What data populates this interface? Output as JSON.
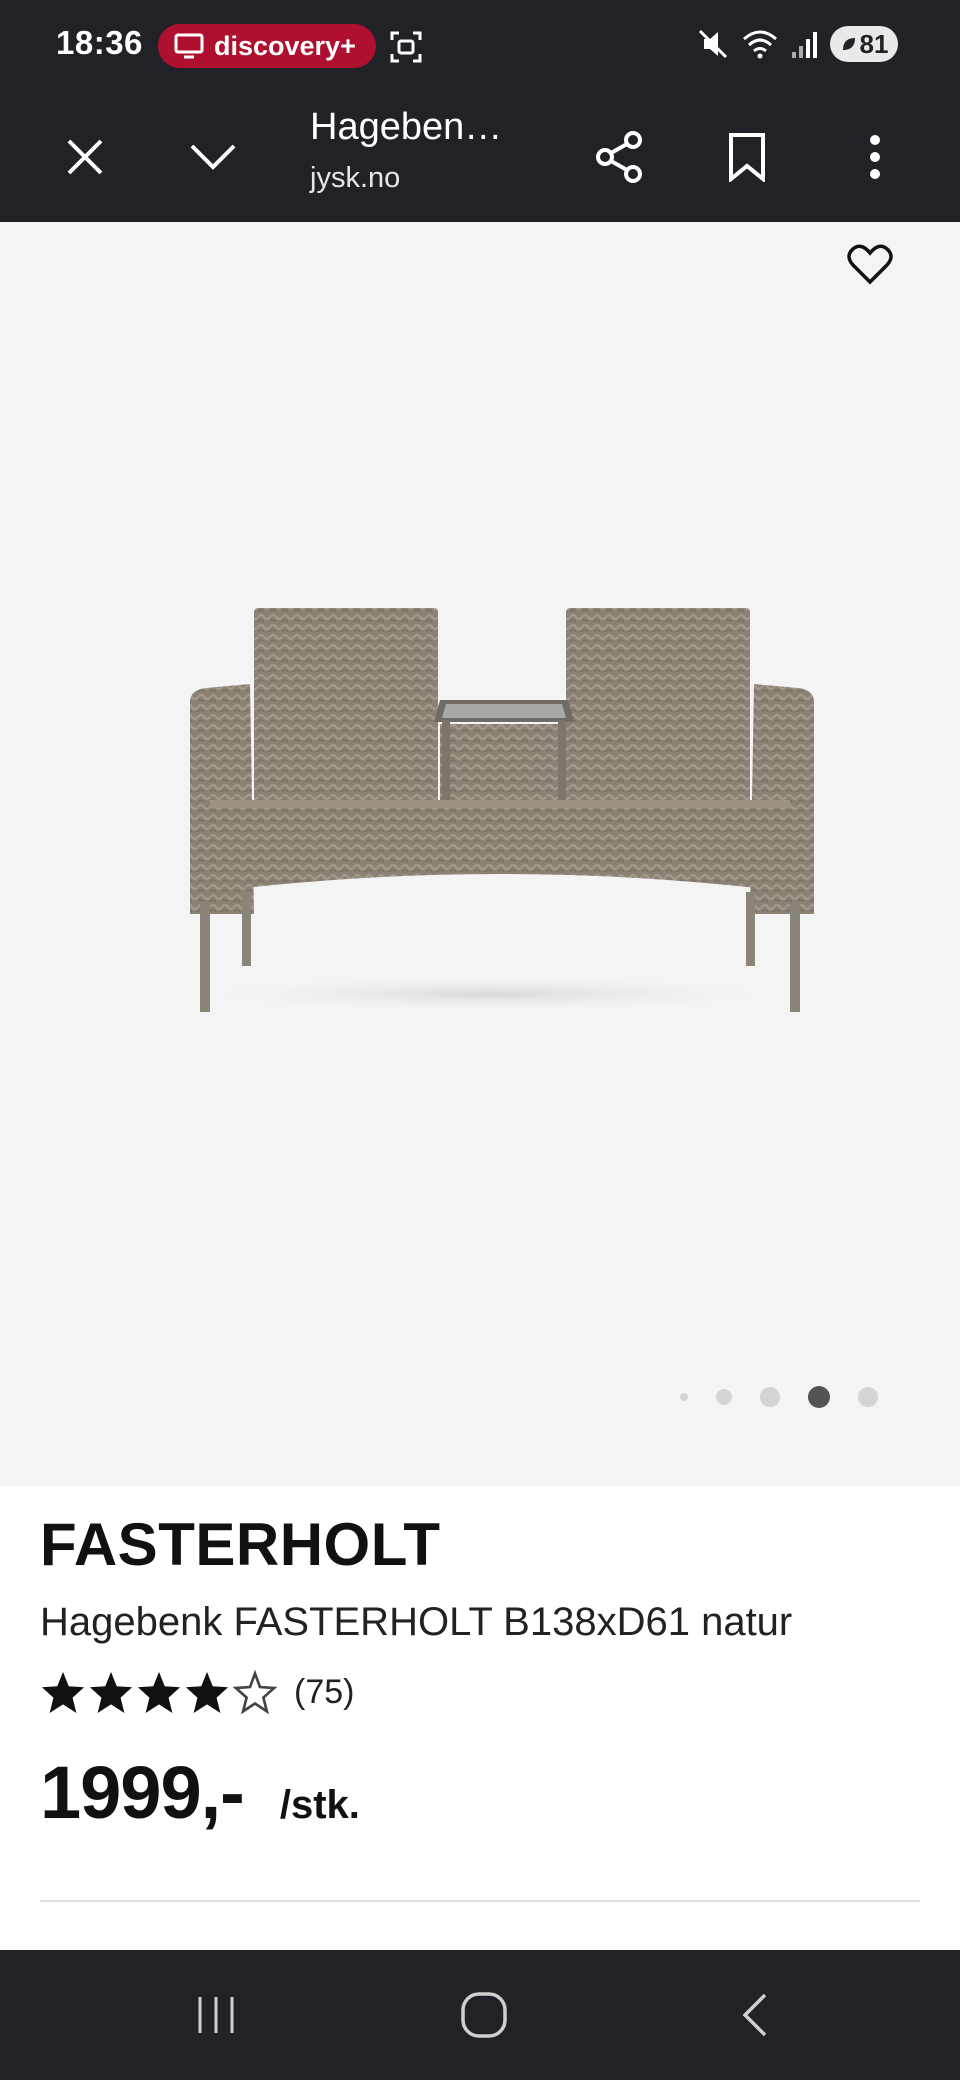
{
  "status": {
    "time": "18:36",
    "pill_label": "discovery+",
    "battery": "81",
    "icons": [
      "tv-icon",
      "screenshot-icon",
      "mute-icon",
      "wifi-icon",
      "signal-icon",
      "battery-icon"
    ]
  },
  "toolbar": {
    "title": "Hageben…",
    "url": "jysk.no",
    "icons": [
      "close-icon",
      "chevron-down-icon",
      "share-icon",
      "bookmark-icon",
      "more-icon"
    ]
  },
  "gallery": {
    "image_alt": "garden-bench-product-image",
    "dots_total": 5,
    "dots_active": 4,
    "favorite_icon": "heart-icon"
  },
  "product": {
    "brand": "FASTERHOLT",
    "name": "Hagebenk FASTERHOLT B138xD61 natur",
    "rating": 4,
    "rating_max": 5,
    "review_count": "(75)",
    "price": "1999,-",
    "unit": "/stk."
  },
  "colors": {
    "chrome": "#202227",
    "pill": "#b0102f",
    "gallery_bg": "#f4f4f4",
    "text": "#111111"
  }
}
